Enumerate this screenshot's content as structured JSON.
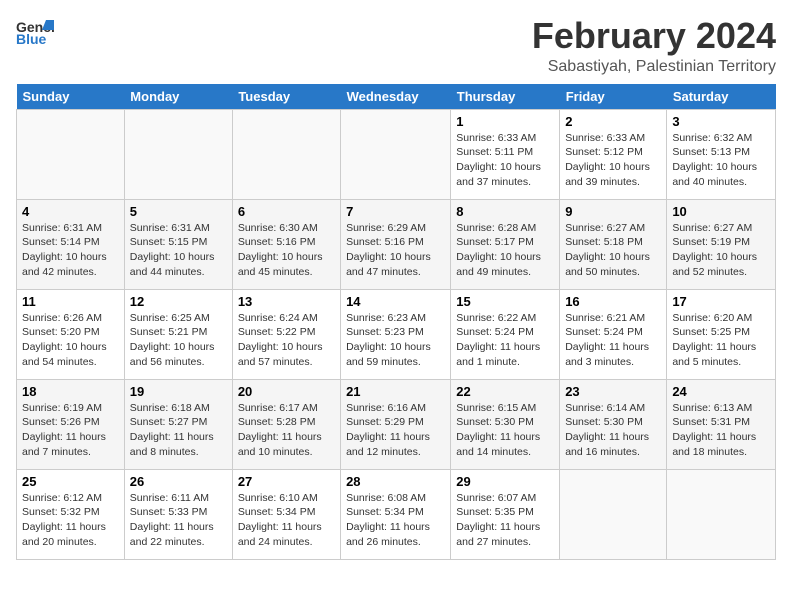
{
  "app": {
    "name_part1": "General",
    "name_part2": "Blue"
  },
  "title": "February 2024",
  "location": "Sabastiyah, Palestinian Territory",
  "days_of_week": [
    "Sunday",
    "Monday",
    "Tuesday",
    "Wednesday",
    "Thursday",
    "Friday",
    "Saturday"
  ],
  "weeks": [
    [
      {
        "day": "",
        "info": ""
      },
      {
        "day": "",
        "info": ""
      },
      {
        "day": "",
        "info": ""
      },
      {
        "day": "",
        "info": ""
      },
      {
        "day": "1",
        "info": "Sunrise: 6:33 AM\nSunset: 5:11 PM\nDaylight: 10 hours\nand 37 minutes."
      },
      {
        "day": "2",
        "info": "Sunrise: 6:33 AM\nSunset: 5:12 PM\nDaylight: 10 hours\nand 39 minutes."
      },
      {
        "day": "3",
        "info": "Sunrise: 6:32 AM\nSunset: 5:13 PM\nDaylight: 10 hours\nand 40 minutes."
      }
    ],
    [
      {
        "day": "4",
        "info": "Sunrise: 6:31 AM\nSunset: 5:14 PM\nDaylight: 10 hours\nand 42 minutes."
      },
      {
        "day": "5",
        "info": "Sunrise: 6:31 AM\nSunset: 5:15 PM\nDaylight: 10 hours\nand 44 minutes."
      },
      {
        "day": "6",
        "info": "Sunrise: 6:30 AM\nSunset: 5:16 PM\nDaylight: 10 hours\nand 45 minutes."
      },
      {
        "day": "7",
        "info": "Sunrise: 6:29 AM\nSunset: 5:16 PM\nDaylight: 10 hours\nand 47 minutes."
      },
      {
        "day": "8",
        "info": "Sunrise: 6:28 AM\nSunset: 5:17 PM\nDaylight: 10 hours\nand 49 minutes."
      },
      {
        "day": "9",
        "info": "Sunrise: 6:27 AM\nSunset: 5:18 PM\nDaylight: 10 hours\nand 50 minutes."
      },
      {
        "day": "10",
        "info": "Sunrise: 6:27 AM\nSunset: 5:19 PM\nDaylight: 10 hours\nand 52 minutes."
      }
    ],
    [
      {
        "day": "11",
        "info": "Sunrise: 6:26 AM\nSunset: 5:20 PM\nDaylight: 10 hours\nand 54 minutes."
      },
      {
        "day": "12",
        "info": "Sunrise: 6:25 AM\nSunset: 5:21 PM\nDaylight: 10 hours\nand 56 minutes."
      },
      {
        "day": "13",
        "info": "Sunrise: 6:24 AM\nSunset: 5:22 PM\nDaylight: 10 hours\nand 57 minutes."
      },
      {
        "day": "14",
        "info": "Sunrise: 6:23 AM\nSunset: 5:23 PM\nDaylight: 10 hours\nand 59 minutes."
      },
      {
        "day": "15",
        "info": "Sunrise: 6:22 AM\nSunset: 5:24 PM\nDaylight: 11 hours\nand 1 minute."
      },
      {
        "day": "16",
        "info": "Sunrise: 6:21 AM\nSunset: 5:24 PM\nDaylight: 11 hours\nand 3 minutes."
      },
      {
        "day": "17",
        "info": "Sunrise: 6:20 AM\nSunset: 5:25 PM\nDaylight: 11 hours\nand 5 minutes."
      }
    ],
    [
      {
        "day": "18",
        "info": "Sunrise: 6:19 AM\nSunset: 5:26 PM\nDaylight: 11 hours\nand 7 minutes."
      },
      {
        "day": "19",
        "info": "Sunrise: 6:18 AM\nSunset: 5:27 PM\nDaylight: 11 hours\nand 8 minutes."
      },
      {
        "day": "20",
        "info": "Sunrise: 6:17 AM\nSunset: 5:28 PM\nDaylight: 11 hours\nand 10 minutes."
      },
      {
        "day": "21",
        "info": "Sunrise: 6:16 AM\nSunset: 5:29 PM\nDaylight: 11 hours\nand 12 minutes."
      },
      {
        "day": "22",
        "info": "Sunrise: 6:15 AM\nSunset: 5:30 PM\nDaylight: 11 hours\nand 14 minutes."
      },
      {
        "day": "23",
        "info": "Sunrise: 6:14 AM\nSunset: 5:30 PM\nDaylight: 11 hours\nand 16 minutes."
      },
      {
        "day": "24",
        "info": "Sunrise: 6:13 AM\nSunset: 5:31 PM\nDaylight: 11 hours\nand 18 minutes."
      }
    ],
    [
      {
        "day": "25",
        "info": "Sunrise: 6:12 AM\nSunset: 5:32 PM\nDaylight: 11 hours\nand 20 minutes."
      },
      {
        "day": "26",
        "info": "Sunrise: 6:11 AM\nSunset: 5:33 PM\nDaylight: 11 hours\nand 22 minutes."
      },
      {
        "day": "27",
        "info": "Sunrise: 6:10 AM\nSunset: 5:34 PM\nDaylight: 11 hours\nand 24 minutes."
      },
      {
        "day": "28",
        "info": "Sunrise: 6:08 AM\nSunset: 5:34 PM\nDaylight: 11 hours\nand 26 minutes."
      },
      {
        "day": "29",
        "info": "Sunrise: 6:07 AM\nSunset: 5:35 PM\nDaylight: 11 hours\nand 27 minutes."
      },
      {
        "day": "",
        "info": ""
      },
      {
        "day": "",
        "info": ""
      }
    ]
  ]
}
